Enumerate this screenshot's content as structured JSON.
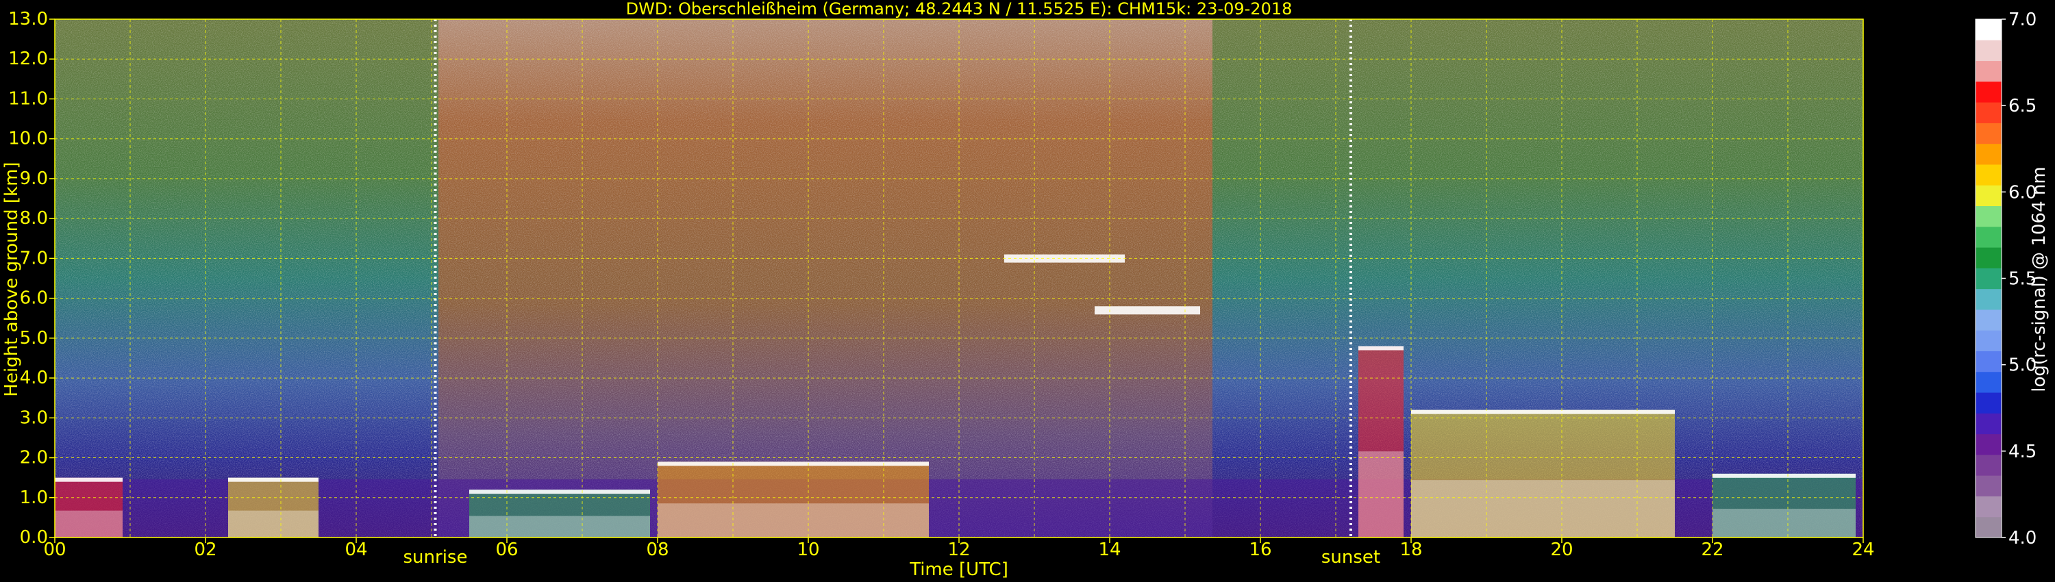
{
  "chart_data": {
    "type": "heatmap",
    "title": "DWD: Oberschleißheim (Germany; 48.2443 N / 11.5525 E):    CHM15k: 23-09-2018",
    "xlabel": "Time [UTC]",
    "ylabel": "Height above ground [km]",
    "xlim": [
      0,
      24
    ],
    "ylim": [
      0,
      13
    ],
    "x_ticks": [
      "00",
      "02",
      "04",
      "06",
      "08",
      "10",
      "12",
      "14",
      "16",
      "18",
      "20",
      "22",
      "24"
    ],
    "y_ticks": [
      "0.0",
      "1.0",
      "2.0",
      "3.0",
      "4.0",
      "5.0",
      "6.0",
      "7.0",
      "8.0",
      "9.0",
      "10.0",
      "11.0",
      "12.0",
      "13.0"
    ],
    "grid": true,
    "markers": [
      {
        "label": "sunrise",
        "x": 5.05
      },
      {
        "label": "sunset",
        "x": 17.2
      }
    ],
    "colorbar": {
      "label": "log(rc-signal) @ 1064 nm",
      "range": [
        4.0,
        7.0
      ],
      "ticks": [
        "4.0",
        "4.5",
        "5.0",
        "5.5",
        "6.0",
        "6.5",
        "7.0"
      ],
      "colors": [
        "#9a8aa0",
        "#a98fb0",
        "#8b5d9e",
        "#7a3e98",
        "#6a1e9a",
        "#4b1fb8",
        "#1f2ad0",
        "#2a5ee8",
        "#5a7ef0",
        "#7a9ef2",
        "#8ab0f0",
        "#5ab8c8",
        "#2aa878",
        "#1a9a3a",
        "#40c060",
        "#80e080",
        "#f0f030",
        "#ffd000",
        "#ffa000",
        "#ff7020",
        "#ff4020",
        "#ff1010",
        "#f0a0a0",
        "#f0d0d0",
        "#ffffff"
      ]
    },
    "cloud_layers": [
      {
        "x_start": 0.0,
        "x_end": 0.9,
        "top_km": 1.5
      },
      {
        "x_start": 2.3,
        "x_end": 3.5,
        "top_km": 1.5
      },
      {
        "x_start": 5.5,
        "x_end": 7.9,
        "top_km": 1.2
      },
      {
        "x_start": 8.0,
        "x_end": 11.6,
        "top_km": 1.9
      },
      {
        "x_start": 12.6,
        "x_end": 14.2,
        "top_km": 7.1
      },
      {
        "x_start": 13.8,
        "x_end": 15.2,
        "top_km": 5.8
      },
      {
        "x_start": 17.3,
        "x_end": 17.9,
        "top_km": 4.8
      },
      {
        "x_start": 18.0,
        "x_end": 21.5,
        "top_km": 3.2
      },
      {
        "x_start": 22.0,
        "x_end": 23.9,
        "top_km": 1.6
      }
    ]
  }
}
